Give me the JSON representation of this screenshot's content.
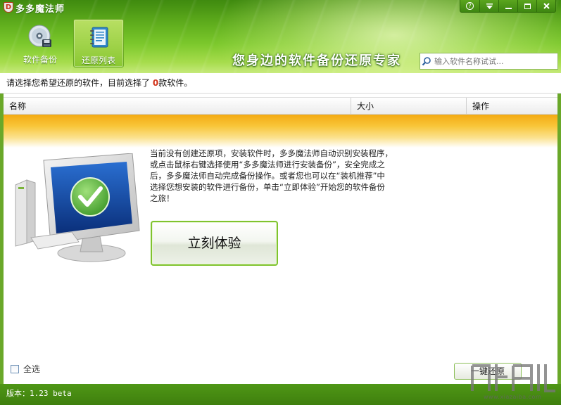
{
  "app": {
    "title": "多多魔法师",
    "logo_letter": "D"
  },
  "window_controls": {
    "help": "?"
  },
  "nav": {
    "tabs": [
      {
        "label": "软件备份",
        "active": false
      },
      {
        "label": "还原列表",
        "active": true
      }
    ]
  },
  "slogan": "您身边的软件备份还原专家",
  "search": {
    "placeholder": "输入软件名称试试..."
  },
  "info": {
    "prefix": "请选择您希望还原的软件，目前选择了 ",
    "count": "0",
    "suffix": "款软件。"
  },
  "table": {
    "columns": [
      "名称",
      "大小",
      "操作"
    ]
  },
  "empty_state": {
    "lines": [
      "当前没有创建还原项，安装软件时，多多魔法师自动识别安装程序，",
      "或点击鼠标右键选择使用“多多魔法师进行安装备份”，安全完成之",
      "后，多多魔法师自动完成备份操作。或者您也可以在“装机推荐”中",
      "选择您想安装的软件进行备份，单击“立即体验”开始您的软件备份",
      "之旅！"
    ],
    "button_label": "立刻体验"
  },
  "footer": {
    "select_all_label": "全选",
    "restore_button_label": "一键还原",
    "version": "版本：1.23 beta"
  },
  "watermark": {
    "site": "www.xiazaiba.com"
  },
  "colors": {
    "header_green": "#62b01e",
    "accent_orange": "#f4aa12",
    "count_red": "#d2341b"
  }
}
